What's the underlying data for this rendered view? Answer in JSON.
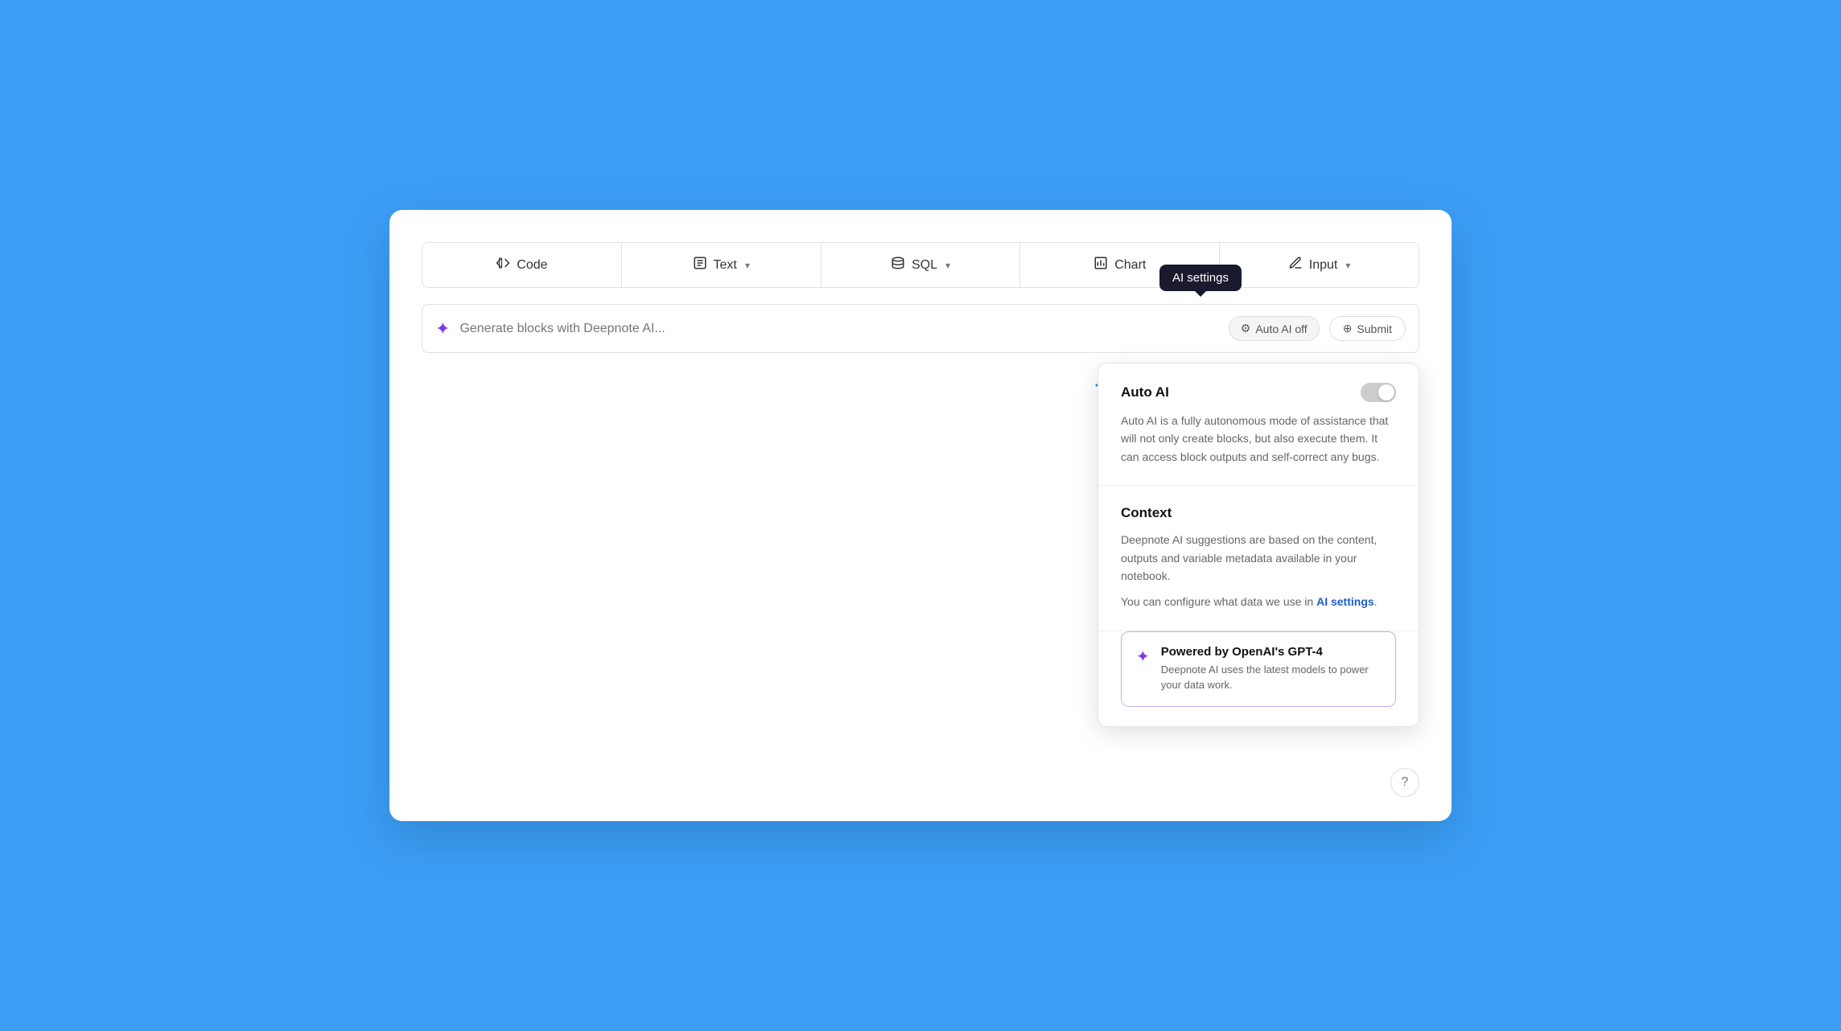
{
  "toolbar": {
    "items": [
      {
        "id": "code",
        "label": "Code",
        "icon": "code"
      },
      {
        "id": "text",
        "label": "Text",
        "icon": "text",
        "hasChevron": true
      },
      {
        "id": "sql",
        "label": "SQL",
        "icon": "sql",
        "hasChevron": true
      },
      {
        "id": "chart",
        "label": "Chart",
        "icon": "chart"
      },
      {
        "id": "input",
        "label": "Input",
        "icon": "input",
        "hasChevron": true
      }
    ]
  },
  "ai_input": {
    "placeholder": "Generate blocks with Deepnote AI...",
    "auto_ai_label": "Auto AI off",
    "submit_label": "Submit"
  },
  "tooltip": {
    "text": "AI settings"
  },
  "settings_panel": {
    "auto_ai": {
      "title": "Auto AI",
      "description": "Auto AI is a fully autonomous mode of assistance that will not only create blocks, but also execute them. It can access block outputs and self-correct any bugs.",
      "toggle_on": false
    },
    "context": {
      "title": "Context",
      "description": "Deepnote AI suggestions are based on the content, outputs and variable metadata available in your notebook.",
      "link_text": "AI settings",
      "link_suffix": ".",
      "pre_link_text": "You can configure what data we use in "
    },
    "gpt4": {
      "title": "Powered by OpenAI's GPT-4",
      "description": "Deepnote AI uses the latest models to power your data work."
    }
  },
  "help": {
    "label": "?"
  }
}
